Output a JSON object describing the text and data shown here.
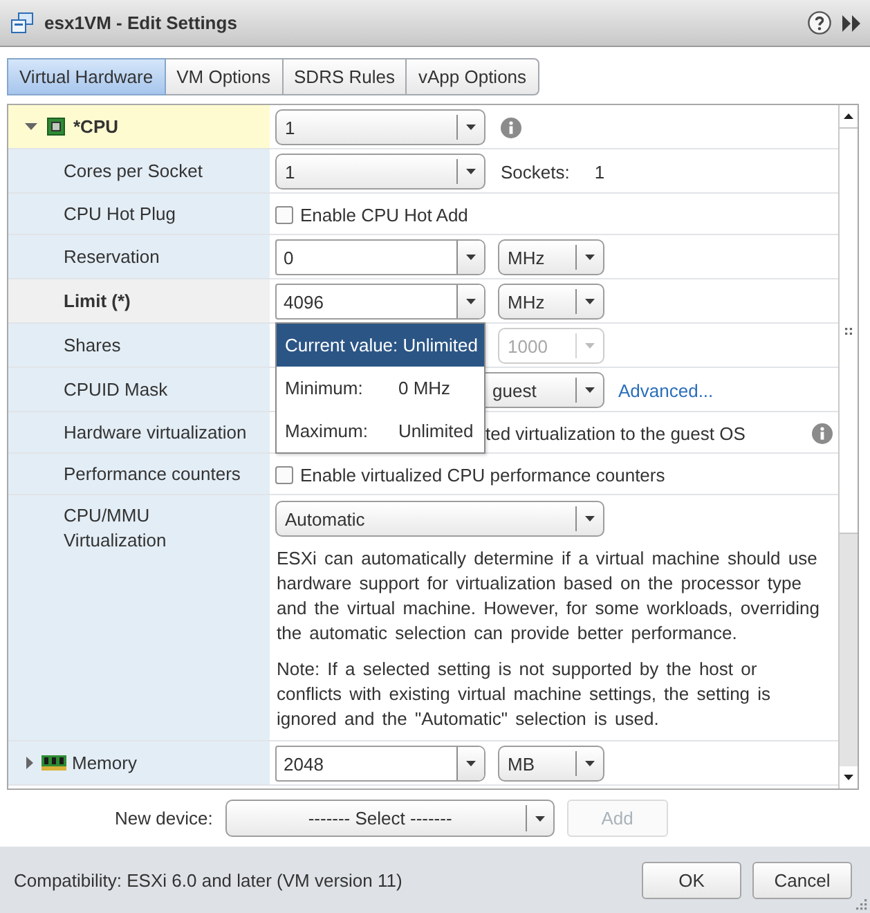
{
  "window": {
    "title": "esx1VM - Edit Settings"
  },
  "tabs": [
    {
      "label": "Virtual Hardware",
      "selected": true
    },
    {
      "label": "VM Options",
      "selected": false
    },
    {
      "label": "SDRS Rules",
      "selected": false
    },
    {
      "label": "vApp Options",
      "selected": false
    }
  ],
  "hardware_rows": [
    {
      "kind": "cpu",
      "label": "*CPU",
      "expanded": true,
      "modified": true,
      "focused": false,
      "controls": [
        {
          "kind": "dropdown",
          "value": "1",
          "disabled": false
        },
        {
          "kind": "info"
        }
      ]
    },
    {
      "kind": "setting",
      "label": "Cores per Socket",
      "modified": false,
      "focused": false,
      "controls": [
        {
          "kind": "dropdown",
          "value": "1",
          "disabled": false
        },
        {
          "kind": "reading",
          "label": "Sockets:",
          "value": "1"
        }
      ]
    },
    {
      "kind": "setting",
      "label": "CPU Hot Plug",
      "modified": false,
      "focused": false,
      "controls": [
        {
          "kind": "checkbox",
          "label": "Enable CPU Hot Add",
          "checked": false
        }
      ]
    },
    {
      "kind": "setting",
      "label": "Reservation",
      "modified": false,
      "focused": false,
      "controls": [
        {
          "kind": "combo",
          "value": "0",
          "disabled": false
        },
        {
          "kind": "unit",
          "value": "MHz",
          "disabled": false
        }
      ]
    },
    {
      "kind": "setting",
      "label": "Limit (*)",
      "modified": false,
      "focused": true,
      "controls": [
        {
          "kind": "combo",
          "value": "4096",
          "disabled": false
        },
        {
          "kind": "unit",
          "value": "MHz",
          "disabled": false
        }
      ],
      "popup": {
        "header": "Current value: Unlimited",
        "rows": [
          {
            "label": "Minimum:",
            "value": "0 MHz"
          },
          {
            "label": "Maximum:",
            "value": "Unlimited"
          }
        ]
      }
    },
    {
      "kind": "setting",
      "label": "Shares",
      "modified": false,
      "focused": false,
      "controls": [
        {
          "kind": "unit",
          "value": "1000",
          "disabled": true
        }
      ]
    },
    {
      "kind": "setting",
      "label": "CPUID Mask",
      "modified": false,
      "focused": false,
      "controls": [
        {
          "kind": "wide-dropdown",
          "value": "guest",
          "disabled": false
        },
        {
          "kind": "link",
          "text": "Advanced..."
        }
      ]
    },
    {
      "kind": "setting",
      "label": "Hardware virtualization",
      "modified": false,
      "focused": false,
      "controls": [
        {
          "kind": "caption",
          "text": "ted virtualization to the guest OS"
        },
        {
          "kind": "info"
        }
      ]
    },
    {
      "kind": "setting",
      "label": "Performance counters",
      "modified": false,
      "focused": false,
      "controls": [
        {
          "kind": "checkbox",
          "label": "Enable virtualized CPU performance counters",
          "checked": false
        }
      ]
    },
    {
      "kind": "setting",
      "label": "CPU/MMU Virtualization",
      "modified": false,
      "focused": false,
      "controls": [
        {
          "kind": "wide-dropdown",
          "value": "Automatic",
          "disabled": false
        },
        {
          "kind": "note",
          "paragraphs": [
            "ESXi can automatically determine if a virtual machine should use hardware support for virtualization based on the processor type and the virtual machine. However, for some workloads, overriding the automatic selection can provide better performance.",
            "Note: If a selected setting is not supported by the host or conflicts with existing virtual machine settings, the setting is ignored and the \"Automatic\" selection is used."
          ]
        }
      ]
    },
    {
      "kind": "memory",
      "label": "Memory",
      "expanded": false,
      "modified": false,
      "focused": false,
      "controls": [
        {
          "kind": "combo",
          "value": "2048",
          "disabled": false
        },
        {
          "kind": "unit",
          "value": "MB",
          "disabled": false
        }
      ]
    }
  ],
  "new_device": {
    "label": "New device:",
    "select": "------- Select -------",
    "add_button": {
      "label": "Add",
      "disabled": true
    }
  },
  "footer": {
    "compatibility": "Compatibility: ESXi 6.0 and later (VM version 11)",
    "buttons": [
      "OK",
      "Cancel"
    ]
  }
}
